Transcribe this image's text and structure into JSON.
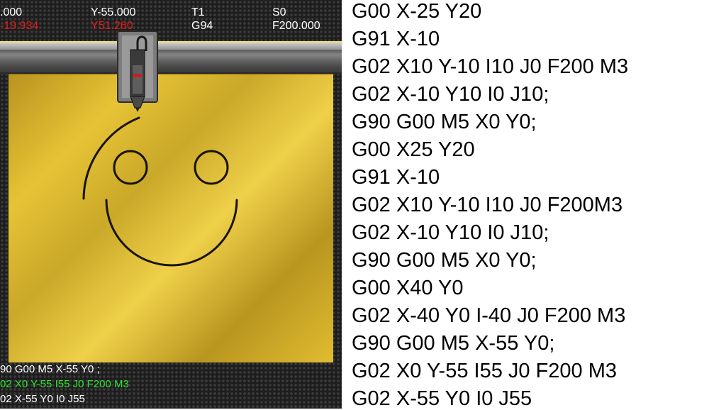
{
  "readout": {
    "x_value": ".000",
    "y_value": "Y-55.000",
    "tool": "T1",
    "spindle": "S0",
    "x_machine": "-19.934",
    "y_machine": "Y51.260",
    "feed_mode": "G94",
    "feed_rate": "F200.000"
  },
  "console": {
    "lines": [
      {
        "text": "90 G00 M5 X-55 Y0 ;",
        "state": "done"
      },
      {
        "text": "02 X0 Y-55 I55 J0 F200 M3",
        "state": "active"
      },
      {
        "text": "02 X-55 Y0 I0 J55",
        "state": "done"
      }
    ]
  },
  "colors": {
    "machine_coord": "#e11b1b",
    "active_line": "#2ee02e",
    "bed": "#d9b42c"
  },
  "gcode_listing": [
    "G00 X-25 Y20",
    "G91 X-10",
    "G02 X10 Y-10 I10 J0 F200 M3",
    "G02 X-10 Y10 I0 J10;",
    "G90 G00 M5 X0 Y0;",
    "G00 X25 Y20",
    "G91 X-10",
    "G02 X10 Y-10 I10 J0 F200M3",
    "G02 X-10 Y10 I0 J10;",
    "G90 G00 M5 X0 Y0;",
    "G00 X40 Y0",
    "G02 X-40 Y0 I-40 J0 F200 M3",
    "G90 G00 M5 X-55 Y0;",
    "G02 X0 Y-55 I55 J0 F200 M3",
    "G02 X-55 Y0 I0 J55"
  ]
}
